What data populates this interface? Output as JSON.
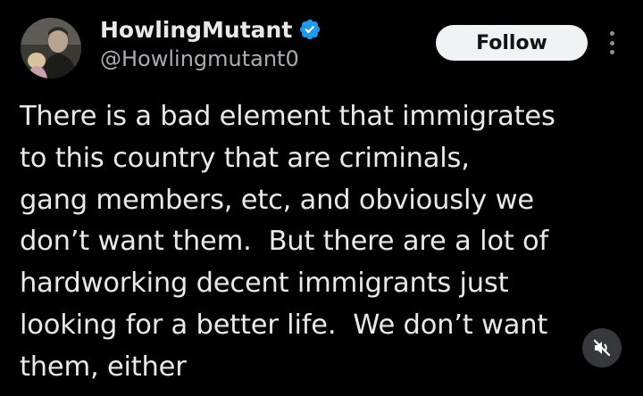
{
  "post": {
    "author": {
      "display_name": "HowlingMutant",
      "handle": "@Howlingmutant0",
      "verified": true,
      "avatar_icon": "profile-photo"
    },
    "follow_label": "Follow",
    "more_icon": "more-options-icon",
    "text_lines": [
      "There is a bad element that immigrates",
      "to this country that are criminals,",
      "gang members, etc, and obviously we",
      "don’t want them.  But there are a lot of",
      "hardworking decent immigrants just",
      "looking for a better life.  We don’t want",
      "them, either"
    ],
    "media_control_icon": "muted-speaker-icon"
  },
  "colors": {
    "background": "#000000",
    "text_primary": "#e7e9ea",
    "text_secondary": "#a9aeb3",
    "verified_badge": "#1d9bf0",
    "follow_button_bg": "#eff3f4",
    "follow_button_text": "#0f1419"
  }
}
